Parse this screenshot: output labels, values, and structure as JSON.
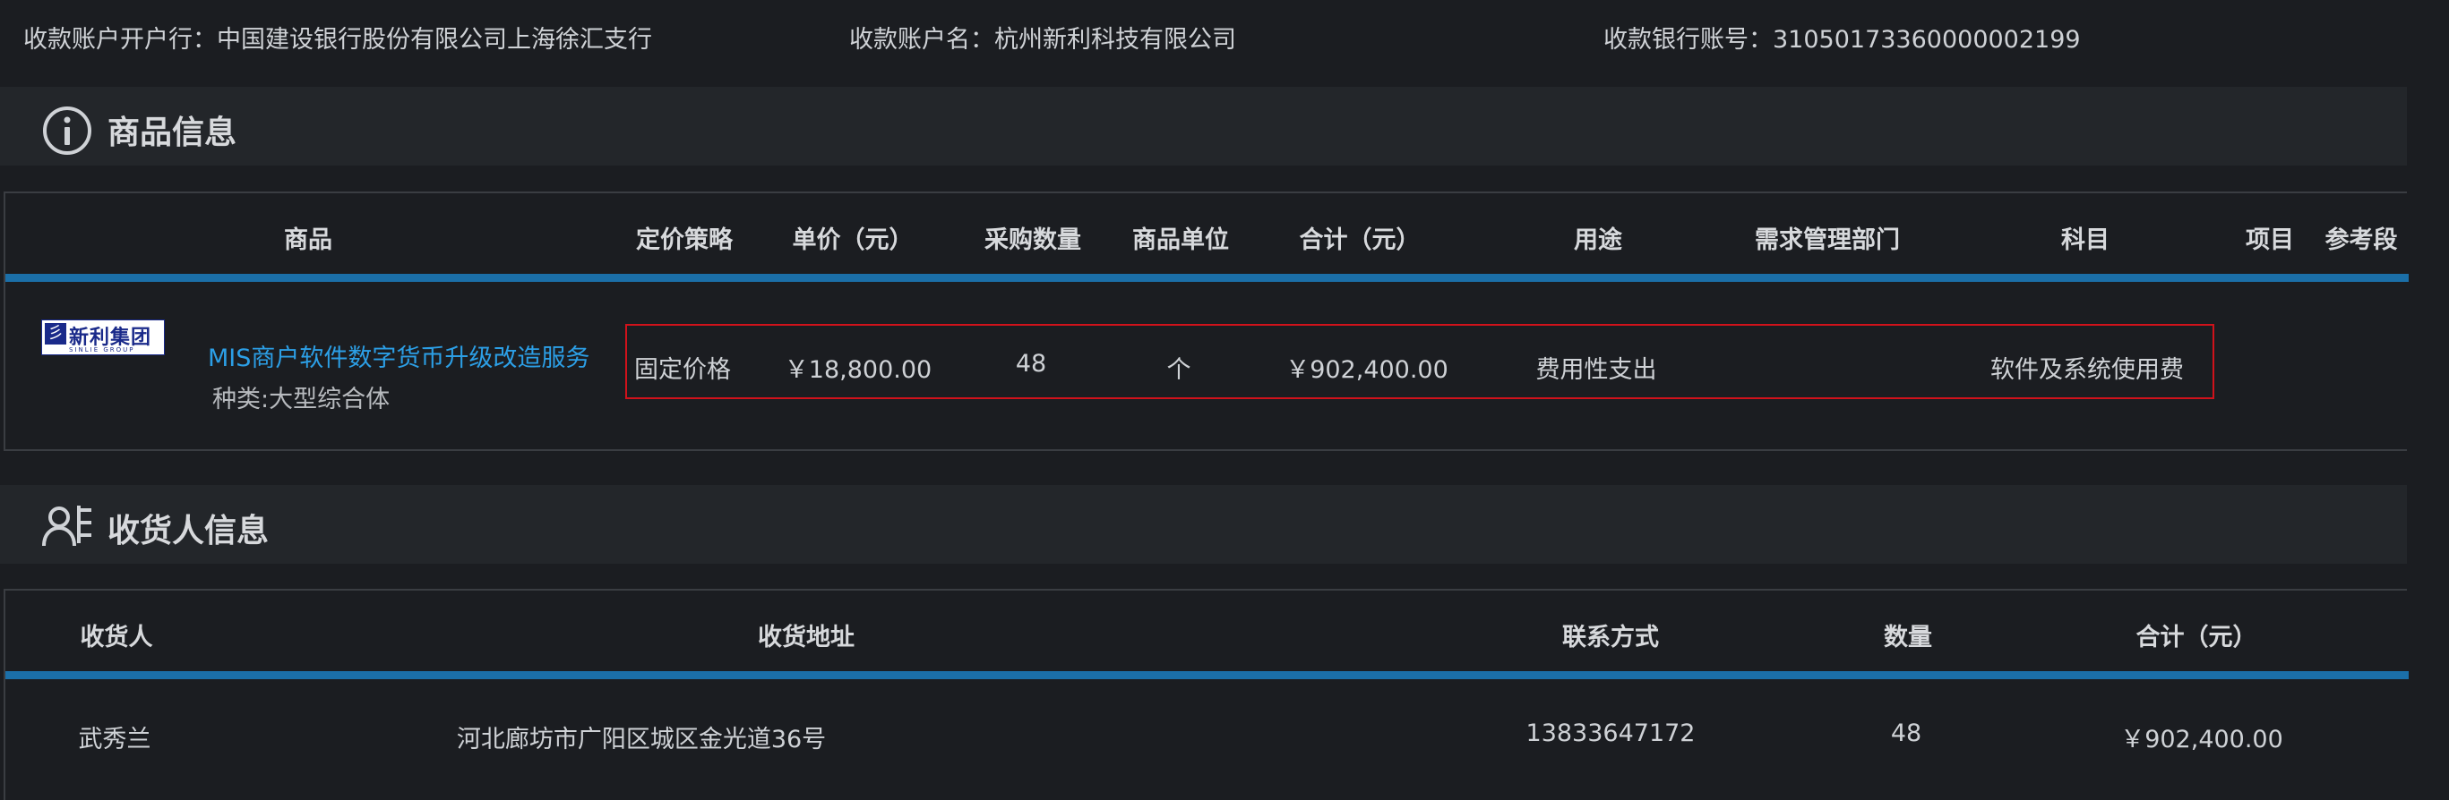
{
  "account": {
    "bank_label": "收款账户开户行：",
    "bank_value": "中国建设银行股份有限公司上海徐汇支行",
    "name_label": "收款账户名：",
    "name_value": "杭州新利科技有限公司",
    "number_label": "收款银行账号：",
    "number_value": "31050173360000002199"
  },
  "product_section": {
    "title": "商品信息",
    "icon": "info-circle-icon",
    "columns": [
      "商品",
      "定价策略",
      "单价（元）",
      "采购数量",
      "商品单位",
      "合计（元）",
      "用途",
      "需求管理部门",
      "科目",
      "项目",
      "参考段"
    ],
    "row": {
      "logo_text": "新利集团",
      "logo_sub": "SINLIE GROUP",
      "product_name": "MIS商户软件数字货币升级改造服务",
      "category": "种类:大型综合体",
      "pricing": "固定价格",
      "unit_price": "￥18,800.00",
      "quantity": "48",
      "unit": "个",
      "total": "￥902,400.00",
      "usage": "费用性支出",
      "department": "",
      "subject": "软件及系统使用费",
      "project": "",
      "reference": ""
    }
  },
  "receiver_section": {
    "title": "收货人信息",
    "icon": "receiver-card-icon",
    "columns": [
      "收货人",
      "收货地址",
      "联系方式",
      "数量",
      "合计（元）"
    ],
    "row": {
      "receiver": "武秀兰",
      "address": "河北廊坊市广阳区城区金光道36号",
      "contact": "13833647172",
      "quantity": "48",
      "total": "￥902,400.00"
    }
  },
  "colors": {
    "background": "#1b1d21",
    "header_bg": "#23262a",
    "accent_rule": "#1b6fa8",
    "link": "#2c9fe6",
    "highlight_border": "#d0121b"
  }
}
